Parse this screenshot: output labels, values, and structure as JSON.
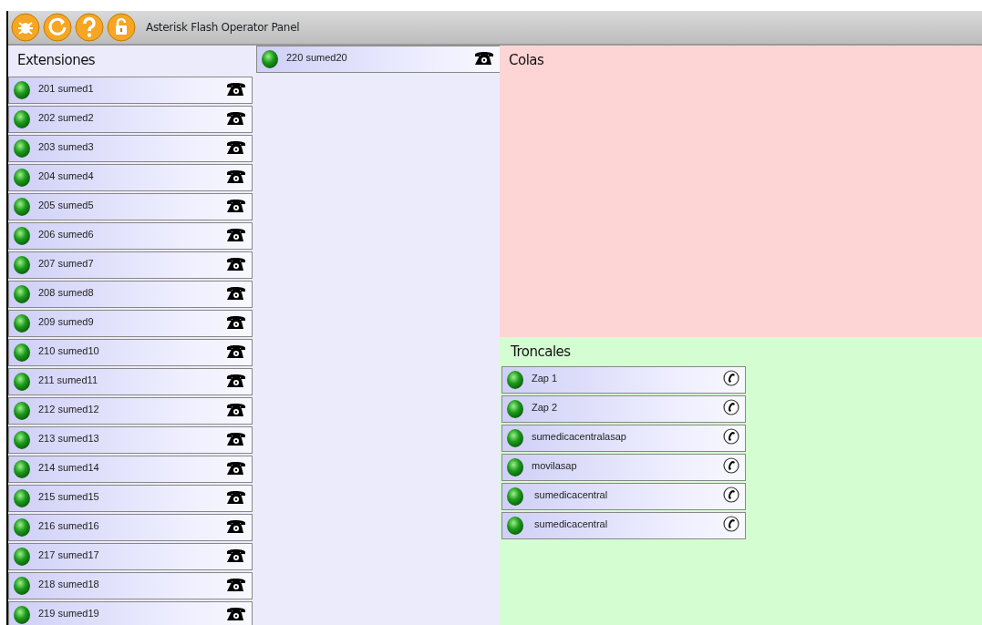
{
  "window": {
    "title": "Asterisk Flash Operator Panel"
  },
  "toolbar": {
    "buttons": [
      {
        "kind": "debug"
      },
      {
        "kind": "reload"
      },
      {
        "kind": "help"
      },
      {
        "kind": "lock"
      }
    ]
  },
  "extensions": {
    "title": "Extensiones",
    "columns": [
      {
        "items": [
          {
            "label": "201 sumed1"
          },
          {
            "label": "202 sumed2"
          },
          {
            "label": "203 sumed3"
          },
          {
            "label": "204 sumed4"
          },
          {
            "label": "205 sumed5"
          },
          {
            "label": "206 sumed6"
          },
          {
            "label": "207 sumed7"
          },
          {
            "label": "208 sumed8"
          },
          {
            "label": "209 sumed9"
          },
          {
            "label": "210 sumed10"
          },
          {
            "label": "211 sumed11"
          },
          {
            "label": "212 sumed12"
          },
          {
            "label": "213 sumed13"
          },
          {
            "label": "214 sumed14"
          },
          {
            "label": "215 sumed15"
          },
          {
            "label": "216 sumed16"
          },
          {
            "label": "217 sumed17"
          },
          {
            "label": "218 sumed18"
          },
          {
            "label": "219 sumed19"
          }
        ]
      },
      {
        "items": [
          {
            "label": "220 sumed20"
          }
        ]
      }
    ]
  },
  "queues": {
    "title": "Colas"
  },
  "trunks": {
    "title": "Troncales",
    "items": [
      {
        "label": "Zap 1"
      },
      {
        "label": "Zap 2"
      },
      {
        "label": "sumedicacentralasap"
      },
      {
        "label": "movilasap"
      },
      {
        "label": " sumedicacentral"
      },
      {
        "label": " sumedicacentral"
      }
    ]
  }
}
